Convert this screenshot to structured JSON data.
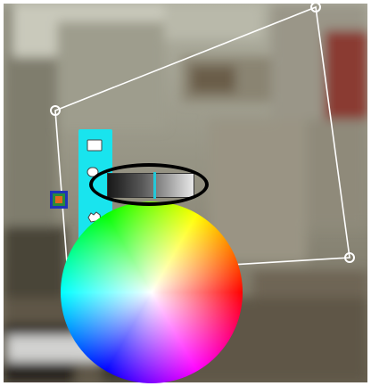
{
  "app": {
    "description_free": true
  },
  "photo_background": {
    "colors": {
      "wall_upper": "#a7a799",
      "wall_mid": "#8c8a7a",
      "floor": "#6e6556",
      "desk_dark": "#2e2b25",
      "paper": "#d2d2d0"
    }
  },
  "selection_polygon": {
    "stroke_color": "#ffffff",
    "vertex_count": 4
  },
  "toolbar": {
    "background": "#19e4ee",
    "tools": [
      {
        "name": "rectangle-tool",
        "icon": "rectangle-icon"
      },
      {
        "name": "slot-tool",
        "icon": "slot-icon"
      },
      {
        "name": "hand-tool",
        "icon": "hand-icon"
      }
    ]
  },
  "side_handle": {
    "border_color": "#1f33b8",
    "fill_color": "#2a8a3a",
    "inner_color": "#e4661e"
  },
  "gray_slider": {
    "value_fraction": 0.55,
    "thumb_color": "#24c8d8",
    "ring_color": "#000000"
  },
  "color_wheel": {
    "segments": 24,
    "center_color": "#ffffff"
  }
}
